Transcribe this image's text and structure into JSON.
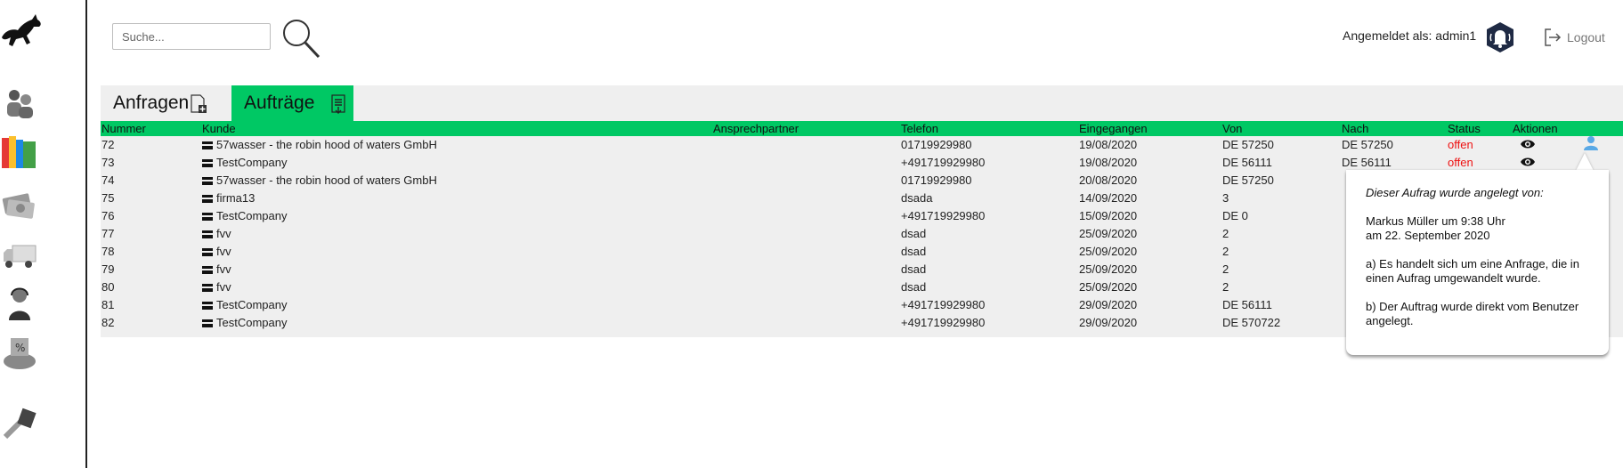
{
  "topbar": {
    "search_placeholder": "Suche...",
    "login_label": "Angemeldet als: admin1",
    "logout_label": "Logout"
  },
  "sidebar": {
    "items": [
      {
        "icon": "horse-logo-icon"
      },
      {
        "icon": "customers-icon"
      },
      {
        "icon": "books-icon"
      },
      {
        "icon": "money-icon"
      },
      {
        "icon": "truck-icon"
      },
      {
        "icon": "support-agent-icon"
      },
      {
        "icon": "accounting-icon"
      },
      {
        "icon": "tools-icon"
      }
    ]
  },
  "tabs": [
    {
      "label": "Anfragen",
      "active": false
    },
    {
      "label": "Aufträge",
      "active": true
    }
  ],
  "colors": {
    "accent": "#00c864",
    "status_open": "#ee1111",
    "row_bg": "#efefef"
  },
  "table": {
    "headers": [
      "Nummer",
      "Kunde",
      "Ansprechpartner",
      "Telefon",
      "Eingegangen",
      "Von",
      "Nach",
      "Status",
      "Aktionen"
    ],
    "rows": [
      {
        "nummer": "72",
        "kunde": "57wasser - the robin hood of waters GmbH",
        "ansprechpartner": "",
        "telefon": "01719929980",
        "eingegangen": "19/08/2020",
        "von": "DE 57250",
        "nach": "DE 57250",
        "status": "offen"
      },
      {
        "nummer": "73",
        "kunde": "TestCompany",
        "ansprechpartner": "",
        "telefon": "+491719929980",
        "eingegangen": "19/08/2020",
        "von": "DE 56111",
        "nach": "DE 56111",
        "status": "offen"
      },
      {
        "nummer": "74",
        "kunde": "57wasser - the robin hood of waters GmbH",
        "ansprechpartner": "",
        "telefon": "01719929980",
        "eingegangen": "20/08/2020",
        "von": "DE 57250",
        "nach": "",
        "status": ""
      },
      {
        "nummer": "75",
        "kunde": "firma13",
        "ansprechpartner": "",
        "telefon": "dsada",
        "eingegangen": "14/09/2020",
        "von": "3",
        "nach": "",
        "status": ""
      },
      {
        "nummer": "76",
        "kunde": "TestCompany",
        "ansprechpartner": "",
        "telefon": "+491719929980",
        "eingegangen": "15/09/2020",
        "von": "DE 0",
        "nach": "",
        "status": ""
      },
      {
        "nummer": "77",
        "kunde": "fvv",
        "ansprechpartner": "",
        "telefon": "dsad",
        "eingegangen": "25/09/2020",
        "von": "2",
        "nach": "",
        "status": ""
      },
      {
        "nummer": "78",
        "kunde": "fvv",
        "ansprechpartner": "",
        "telefon": "dsad",
        "eingegangen": "25/09/2020",
        "von": "2",
        "nach": "",
        "status": ""
      },
      {
        "nummer": "79",
        "kunde": "fvv",
        "ansprechpartner": "",
        "telefon": "dsad",
        "eingegangen": "25/09/2020",
        "von": "2",
        "nach": "",
        "status": ""
      },
      {
        "nummer": "80",
        "kunde": "fvv",
        "ansprechpartner": "",
        "telefon": "dsad",
        "eingegangen": "25/09/2020",
        "von": "2",
        "nach": "",
        "status": ""
      },
      {
        "nummer": "81",
        "kunde": "TestCompany",
        "ansprechpartner": "",
        "telefon": "+491719929980",
        "eingegangen": "29/09/2020",
        "von": "DE 56111",
        "nach": "",
        "status": ""
      },
      {
        "nummer": "82",
        "kunde": "TestCompany",
        "ansprechpartner": "",
        "telefon": "+491719929980",
        "eingegangen": "29/09/2020",
        "von": "DE 570722",
        "nach": "",
        "status": ""
      }
    ]
  },
  "tooltip": {
    "title": "Dieser Aufrag wurde angelegt von:",
    "line1": "Markus Müller um 9:38 Uhr",
    "line2": "am 22. September 2020",
    "para_a": "a) Es handelt sich um eine Anfrage, die in einen Aufrag umgewandelt wurde.",
    "para_b": "b) Der Auftrag wurde direkt vom Benutzer angelegt."
  }
}
